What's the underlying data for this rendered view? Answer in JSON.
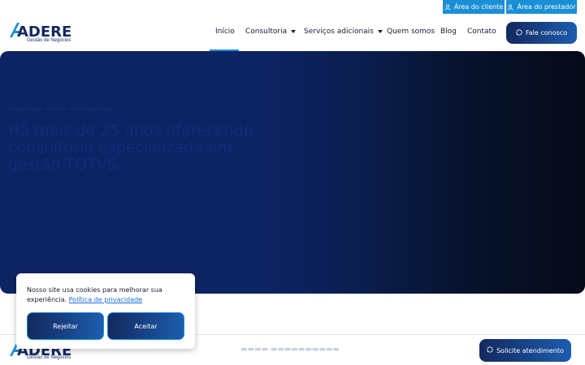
{
  "colors": {
    "accent": "#1a8fd6",
    "brand_dark": "#13295e",
    "hero_blue": "#0d2464"
  },
  "topbar": {
    "client_area": {
      "label": "Área do cliente",
      "icon": "user-icon"
    },
    "provider_area": {
      "label": "Área do prestador",
      "icon": "user-icon"
    }
  },
  "logo": {
    "name": "ADERE",
    "tagline": "Gestão de Negócios"
  },
  "nav": {
    "items": [
      {
        "label": "Início",
        "active": true
      },
      {
        "label": "Consultoria",
        "has_dropdown": true
      },
      {
        "label": "Serviços adicionais",
        "has_dropdown": true
      },
      {
        "label": "Quem somos"
      },
      {
        "label": "Blog"
      },
      {
        "label": "Contato"
      }
    ],
    "cta": {
      "label": "Fale conosco",
      "icon": "whatsapp-icon"
    }
  },
  "hero": {
    "title": "Há mais de 25 anos oferecendo consultoria especializada em gestão TOTVS."
  },
  "cookie": {
    "text": "Nosso site usa cookies para melhorar sua experiência.",
    "link": "Política de privacidade",
    "reject": "Rejeitar",
    "accept": "Aceitar"
  },
  "footer": {
    "logo_name": "ADERE",
    "logo_tagline": "Gestão de Negócios",
    "solicite": {
      "label": "Solicite atendimento",
      "icon": "whatsapp-icon"
    }
  }
}
